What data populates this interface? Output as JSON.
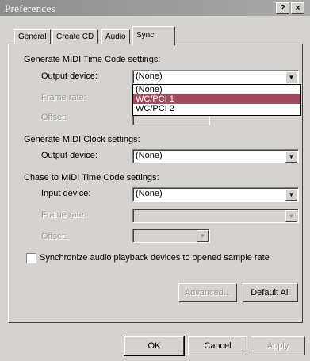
{
  "window": {
    "title": "Preferences",
    "help_glyph": "?",
    "close_glyph": "×"
  },
  "tabs": [
    {
      "label": "General"
    },
    {
      "label": "Create CD"
    },
    {
      "label": "Audio"
    },
    {
      "label": "Sync"
    }
  ],
  "mtc_generate": {
    "heading": "Generate MIDI Time Code settings:",
    "output_label": "Output device:",
    "output_value": "(None)",
    "frame_rate_label": "Frame rate:",
    "offset_label": "Offset:",
    "dropdown_options": [
      "(None)",
      "WC/PCI 1",
      "WC/PCI 2"
    ]
  },
  "clock_generate": {
    "heading": "Generate MIDI Clock settings:",
    "output_label": "Output device:",
    "output_value": "(None)"
  },
  "mtc_chase": {
    "heading": "Chase to MIDI Time Code settings:",
    "input_label": "Input device:",
    "input_value": "(None)",
    "frame_rate_label": "Frame rate:",
    "offset_label": "Offset:"
  },
  "sync_checkbox_label": "Synchronize audio playback devices to opened sample rate",
  "buttons": {
    "advanced": "Advanced...",
    "default_all": "Default All",
    "ok": "OK",
    "cancel": "Cancel",
    "apply": "Apply"
  },
  "icons": {
    "dropdown_arrow": "▼"
  }
}
